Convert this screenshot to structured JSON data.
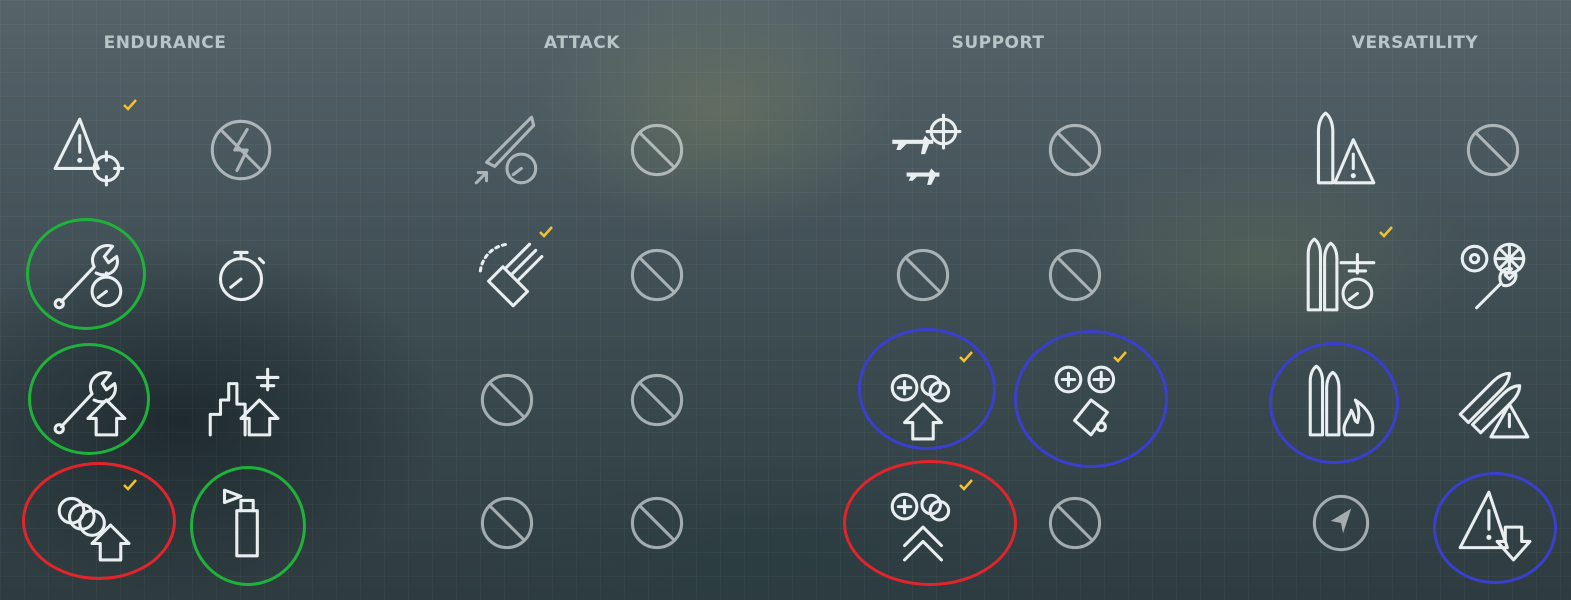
{
  "columns": [
    {
      "id": "endurance",
      "label": "ENDURANCE"
    },
    {
      "id": "attack",
      "label": "ATTACK"
    },
    {
      "id": "support",
      "label": "SUPPORT"
    },
    {
      "id": "versatility",
      "label": "VERSATILITY"
    }
  ],
  "skills": [
    {
      "column": "endurance",
      "row": 1,
      "slot": 1,
      "icon": "warning-target-icon",
      "status": "available",
      "selected": true
    },
    {
      "column": "endurance",
      "row": 1,
      "slot": 2,
      "icon": "no-flash-icon",
      "status": "disabled",
      "selected": false
    },
    {
      "column": "endurance",
      "row": 2,
      "slot": 1,
      "icon": "wrench-timer-icon",
      "status": "available",
      "selected": false,
      "highlight": "green"
    },
    {
      "column": "endurance",
      "row": 2,
      "slot": 2,
      "icon": "stopwatch-icon",
      "status": "available",
      "selected": false
    },
    {
      "column": "endurance",
      "row": 3,
      "slot": 1,
      "icon": "wrench-upgrade-icon",
      "status": "available",
      "selected": false,
      "highlight": "green"
    },
    {
      "column": "endurance",
      "row": 3,
      "slot": 2,
      "icon": "ship-aircraft-upgrade-icon",
      "status": "available",
      "selected": false
    },
    {
      "column": "endurance",
      "row": 4,
      "slot": 1,
      "icon": "aa-guns-upgrade-icon",
      "status": "available",
      "selected": true,
      "highlight": "red"
    },
    {
      "column": "endurance",
      "row": 4,
      "slot": 2,
      "icon": "extinguisher-icon",
      "status": "available",
      "selected": false,
      "highlight": "green"
    },
    {
      "column": "attack",
      "row": 1,
      "slot": 1,
      "icon": "torpedo-timer-icon",
      "status": "dimmed",
      "selected": false
    },
    {
      "column": "attack",
      "row": 1,
      "slot": 2,
      "icon": "unavailable-icon",
      "status": "unavailable",
      "selected": false
    },
    {
      "column": "attack",
      "row": 2,
      "slot": 1,
      "icon": "main-battery-traverse-icon",
      "status": "available",
      "selected": true
    },
    {
      "column": "attack",
      "row": 2,
      "slot": 2,
      "icon": "unavailable-icon",
      "status": "unavailable",
      "selected": false
    },
    {
      "column": "attack",
      "row": 3,
      "slot": 1,
      "icon": "unavailable-icon",
      "status": "unavailable",
      "selected": false
    },
    {
      "column": "attack",
      "row": 3,
      "slot": 2,
      "icon": "unavailable-icon",
      "status": "unavailable",
      "selected": false
    },
    {
      "column": "attack",
      "row": 4,
      "slot": 1,
      "icon": "unavailable-icon",
      "status": "unavailable",
      "selected": false
    },
    {
      "column": "attack",
      "row": 4,
      "slot": 2,
      "icon": "unavailable-icon",
      "status": "unavailable",
      "selected": false
    },
    {
      "column": "support",
      "row": 1,
      "slot": 1,
      "icon": "aircraft-target-icon",
      "status": "available",
      "selected": false
    },
    {
      "column": "support",
      "row": 1,
      "slot": 2,
      "icon": "unavailable-icon",
      "status": "unavailable",
      "selected": false
    },
    {
      "column": "support",
      "row": 2,
      "slot": 1,
      "icon": "unavailable-icon",
      "status": "unavailable",
      "selected": false
    },
    {
      "column": "support",
      "row": 2,
      "slot": 2,
      "icon": "unavailable-icon",
      "status": "unavailable",
      "selected": false
    },
    {
      "column": "support",
      "row": 3,
      "slot": 1,
      "icon": "aa-sector-upgrade-icon",
      "status": "available",
      "selected": true,
      "highlight": "blue"
    },
    {
      "column": "support",
      "row": 3,
      "slot": 2,
      "icon": "aa-plus-damage-icon",
      "status": "available",
      "selected": true,
      "highlight": "blue"
    },
    {
      "column": "support",
      "row": 4,
      "slot": 1,
      "icon": "aa-double-upgrade-icon",
      "status": "available",
      "selected": true,
      "highlight": "red"
    },
    {
      "column": "support",
      "row": 4,
      "slot": 2,
      "icon": "unavailable-icon",
      "status": "unavailable",
      "selected": false
    },
    {
      "column": "versatility",
      "row": 1,
      "slot": 1,
      "icon": "shell-warning-icon",
      "status": "available",
      "selected": false
    },
    {
      "column": "versatility",
      "row": 1,
      "slot": 2,
      "icon": "unavailable-icon",
      "status": "unavailable",
      "selected": false
    },
    {
      "column": "versatility",
      "row": 2,
      "slot": 1,
      "icon": "shells-aircraft-timer-icon",
      "status": "available",
      "selected": true
    },
    {
      "column": "versatility",
      "row": 2,
      "slot": 2,
      "icon": "gears-wrench-icon",
      "status": "available",
      "selected": false
    },
    {
      "column": "versatility",
      "row": 3,
      "slot": 1,
      "icon": "shells-fire-icon",
      "status": "available",
      "selected": false,
      "highlight": "blue"
    },
    {
      "column": "versatility",
      "row": 3,
      "slot": 2,
      "icon": "torpedoes-warning-icon",
      "status": "available",
      "selected": false
    },
    {
      "column": "versatility",
      "row": 4,
      "slot": 1,
      "icon": "compass-radar-icon",
      "status": "dimmed",
      "selected": false
    },
    {
      "column": "versatility",
      "row": 4,
      "slot": 2,
      "icon": "warning-down-icon",
      "status": "available",
      "selected": false,
      "highlight": "blue"
    }
  ],
  "colors": {
    "title": "#b9c6c8",
    "icon": "#e9eef0",
    "checkmark": "#f2c230",
    "highlight_green": "#1fb23a",
    "highlight_red": "#e3242b",
    "highlight_blue": "#3b3fd0"
  }
}
